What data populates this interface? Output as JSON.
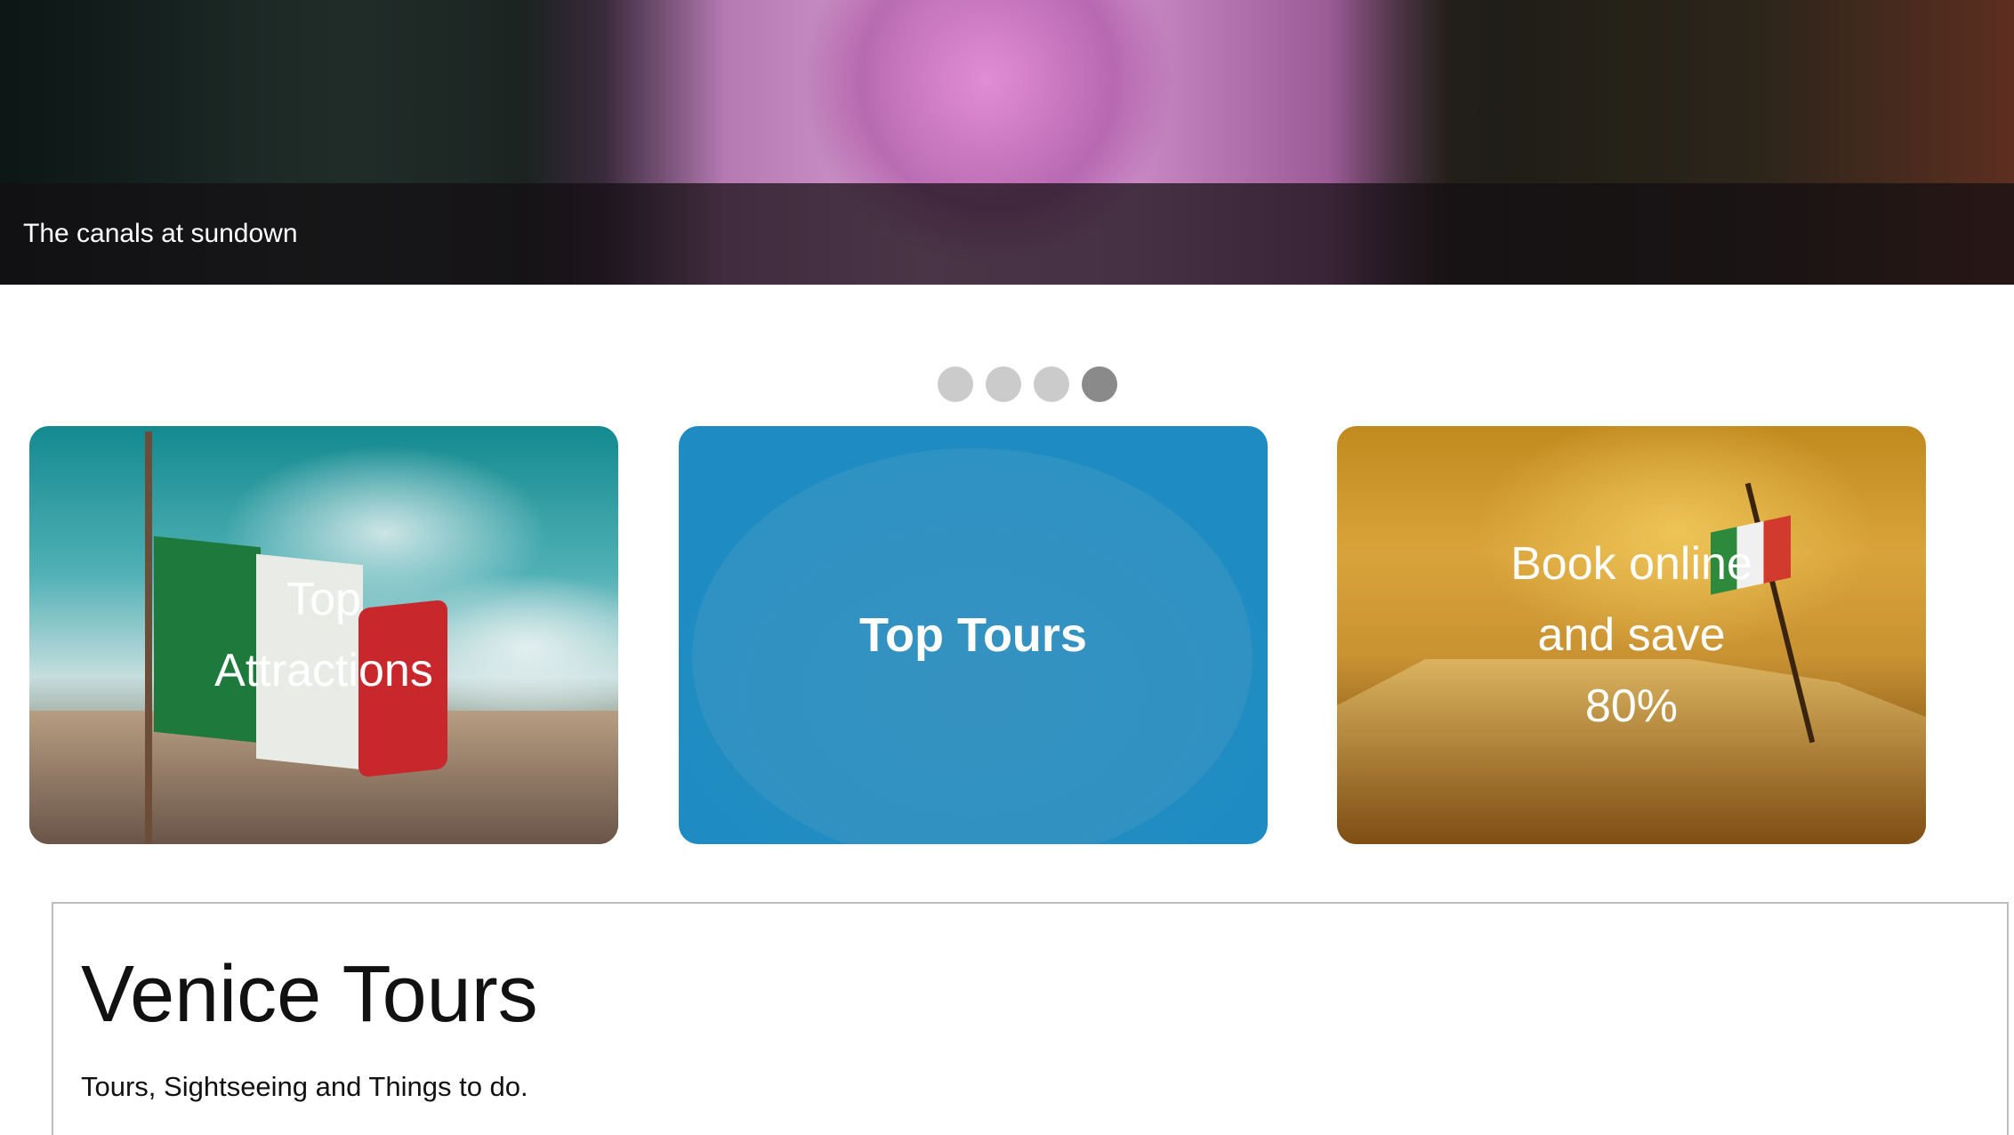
{
  "hero": {
    "caption": "The canals at sundown",
    "slide_count": 4,
    "active_slide": 4
  },
  "cards": [
    {
      "id": "top-attractions",
      "label_lines": [
        "Top",
        "Attractions"
      ],
      "bold": false
    },
    {
      "id": "top-tours",
      "label_lines": [
        "Top Tours"
      ],
      "bold": true
    },
    {
      "id": "book-online",
      "label_lines": [
        "Book online",
        "and save",
        "80%"
      ],
      "bold": false
    }
  ],
  "info": {
    "title": "Venice Tours",
    "subtitle": "Tours, Sightseeing and Things to do."
  },
  "colors": {
    "dot_inactive": "#cbcbcb",
    "dot_active": "#8a8a8a",
    "tours_card_bg": "#1f91c2"
  }
}
